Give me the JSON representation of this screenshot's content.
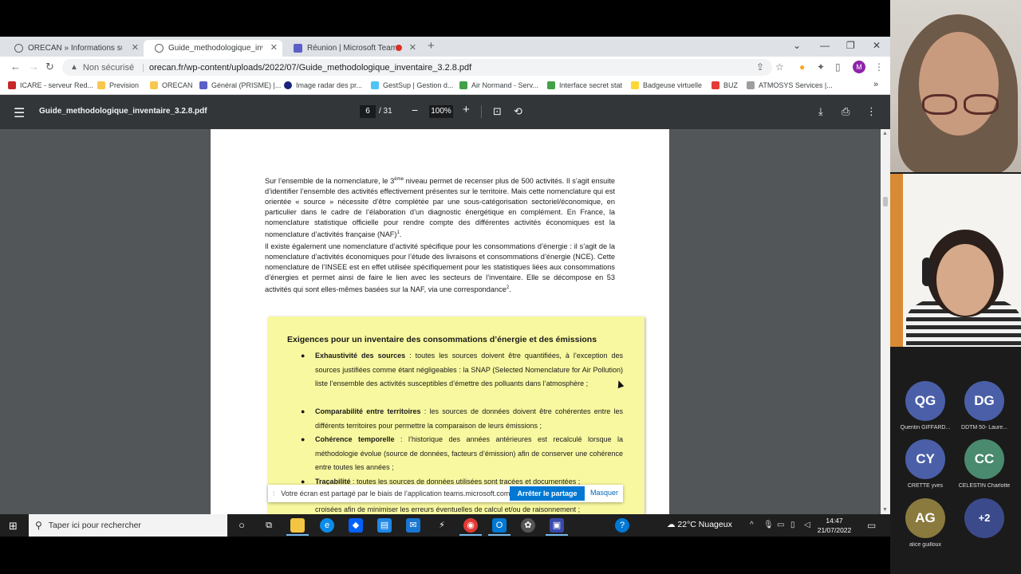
{
  "browser": {
    "tabs": [
      {
        "label": "ORECAN » Informations sur les o",
        "active": false
      },
      {
        "label": "Guide_methodologique_inventai",
        "active": true
      },
      {
        "label": "Réunion | Microsoft Teams",
        "active": false
      }
    ],
    "omnibox": {
      "security_label": "Non sécurisé",
      "url": "orecan.fr/wp-content/uploads/2022/07/Guide_methodologique_inventaire_3.2.8.pdf"
    },
    "profile_initial": "M",
    "bookmarks": [
      {
        "label": "ICARE - serveur Red...",
        "color": "#c62828"
      },
      {
        "label": "Prevision",
        "color": "#f9c74f"
      },
      {
        "label": "ORECAN",
        "color": "#f9c74f"
      },
      {
        "label": "Général (PRISME) |...",
        "color": "#5b5fc7"
      },
      {
        "label": "Image radar des pr...",
        "color": "#1a237e"
      },
      {
        "label": "GestSup | Gestion d...",
        "color": "#4fc3f7"
      },
      {
        "label": "Air Normand - Serv...",
        "color": "#43a047"
      },
      {
        "label": "Interface secret stat",
        "color": "#43a047"
      },
      {
        "label": "Badgeuse virtuelle",
        "color": "#fdd835"
      },
      {
        "label": "BUZ",
        "color": "#e53935"
      },
      {
        "label": "ATMOSYS Services |...",
        "color": "#9e9e9e"
      }
    ],
    "more_bookmarks": "»"
  },
  "pdf": {
    "filename": "Guide_methodologique_inventaire_3.2.8.pdf",
    "current_page": "6",
    "total_pages": "/ 31",
    "zoom": "100%",
    "paragraph1_a": "Sur l’ensemble de la nomenclature, le 3",
    "paragraph1_sup": "ème",
    "paragraph1_b": " niveau permet de recenser plus de 500 activités. Il s’agit ensuite d’identifier l’ensemble des activités effectivement présentes sur le territoire. Mais cette nomenclature qui est orientée « source » nécessite d’être complétée par une sous-catégorisation sectoriel/économique, en particulier dans le cadre de l’élaboration d’un diagnostic énergétique en complément. En France, la nomenclature statistique officielle pour rendre compte des différentes activités économiques est la nomenclature d’activités française (NAF)",
    "paragraph1_fn": "1",
    "paragraph1_end": ".",
    "paragraph2": "Il existe également une nomenclature d’activité spécifique pour les consommations d’énergie : il s’agit de la nomenclature d’activités économiques pour l’étude des livraisons et consommations d’énergie (NCE). Cette nomenclature de l’INSEE est en effet utilisée spécifiquement pour les statistiques liées aux consommations d’énergies et permet ainsi de faire le lien avec les secteurs de l’inventaire. Elle se décompose en 53 activités qui sont elles-mêmes basées sur la NAF, via une correspondance",
    "paragraph2_fn": "2",
    "paragraph2_end": ".",
    "box_title": "Exigences pour un inventaire des consommations d’énergie et des émissions",
    "requirements": [
      {
        "term": "Exhaustivité des sources",
        "text": " : toutes les sources doivent être quantifiées, à l’exception des sources justifiées comme étant négligeables : la SNAP (Selected Nomenclature for Air Pollution) liste l’ensemble des activités susceptibles d’émettre des polluants dans l’atmosphère ;"
      },
      {
        "term": "Comparabilité entre territoires",
        "text": " : les sources de données doivent être cohérentes entre les différents territoires pour permettre la comparaison de leurs émissions ;"
      },
      {
        "term": "Cohérence temporelle",
        "text": " : l’historique des années antérieures est recalculé lorsque la méthodologie évolue (source de données, facteurs d’émission) afin de conserver une cohérence entre toutes les années ;"
      },
      {
        "term": "Traçabilité",
        "text": " : toutes les sources de données utilisées sont tracées et documentées ;"
      }
    ],
    "partial_line": "croisées afin de minimiser les erreurs éventuelles de calcul et/ou de raisonnement ;"
  },
  "share_bar": {
    "message": "Votre écran est partagé par le biais de l’application teams.microsoft.com.",
    "stop_button": "Arrêter le partage",
    "hide_button": "Masquer"
  },
  "taskbar": {
    "search_placeholder": "Taper ici pour rechercher",
    "weather": "22°C  Nuageux",
    "time": "14:47",
    "date": "21/07/2022"
  },
  "teams": {
    "participants": [
      {
        "initials": "QG",
        "name": "Quentin GIFFARD...",
        "color": "#4a5fa8"
      },
      {
        "initials": "DG",
        "name": "DDTM 50- Laure...",
        "color": "#4a5fa8"
      },
      {
        "initials": "CY",
        "name": "CRETTE yves",
        "color": "#4a5fa8"
      },
      {
        "initials": "CC",
        "name": "CELESTIN Charlotte",
        "color": "#4a8a6e"
      },
      {
        "initials": "AG",
        "name": "alice guilloux",
        "color": "#8a7a3e"
      },
      {
        "initials": "+2",
        "name": "",
        "color": "#3b4a8a"
      }
    ]
  }
}
